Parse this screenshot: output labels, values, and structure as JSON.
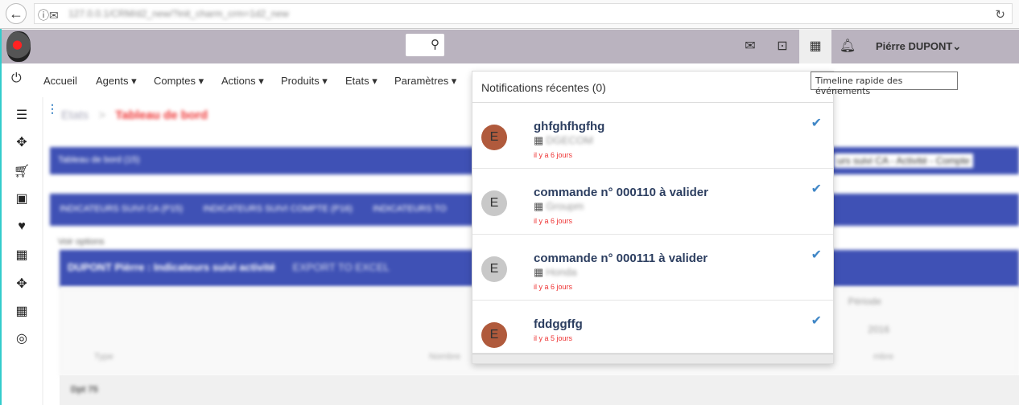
{
  "browser": {
    "url": "127.0.0.1/CRM/d2_new/?init_charm_crm=1d2_new"
  },
  "header": {
    "user_name": "Piérre DUPONT",
    "search_icon": "search-icon",
    "icons": [
      "envelope-icon",
      "inbox-icon",
      "calendar-icon",
      "bell-icon"
    ]
  },
  "nav": {
    "items": [
      "Accueil",
      "Agents ▾",
      "Comptes ▾",
      "Actions ▾",
      "Produits ▾",
      "Etats ▾",
      "Paramètres ▾"
    ]
  },
  "breadcrumb": {
    "parent": "Etats",
    "sep": ">",
    "current": "Tableau de bord"
  },
  "content": {
    "band1": "Tableau de bord (15)",
    "band1_right": "urs suivi CA - Activité - Compte",
    "tabs": [
      "INDICATEURS SUIVI CA (P15)",
      "INDICATEURS SUIVI COMPTE (P16)",
      "INDICATEURS TO"
    ],
    "options": "Voir options",
    "panel_title": "DUPONT Pièrre : Indicateurs suivi activité",
    "export": "EXPORT TO EXCEL",
    "col_periode": "Période",
    "year": "2016",
    "col_type": "Type",
    "col_nombre": "Nombre",
    "col_nombre2": "mbre",
    "group": "Dpt 75"
  },
  "notifications": {
    "title": "Notifications récentes (0)",
    "items": [
      {
        "title": "ghfghfhgfhg",
        "company": "DGECOM",
        "time": "il y a 6 jours",
        "avatar": "E",
        "color": "#b05a3c"
      },
      {
        "title": "commande n° 000110 à valider",
        "company": "Groupm",
        "time": "il y a 6 jours",
        "avatar": "E",
        "color": "#c8c8c8"
      },
      {
        "title": "commande n° 000111 à valider",
        "company": "Honda",
        "time": "il y a 6 jours",
        "avatar": "E",
        "color": "#c8c8c8"
      },
      {
        "title": "fddggffg",
        "company": "",
        "time": "il y a 5 jours",
        "avatar": "E",
        "color": "#b05a3c"
      }
    ]
  },
  "tooltip": "Timeline rapide des événements"
}
